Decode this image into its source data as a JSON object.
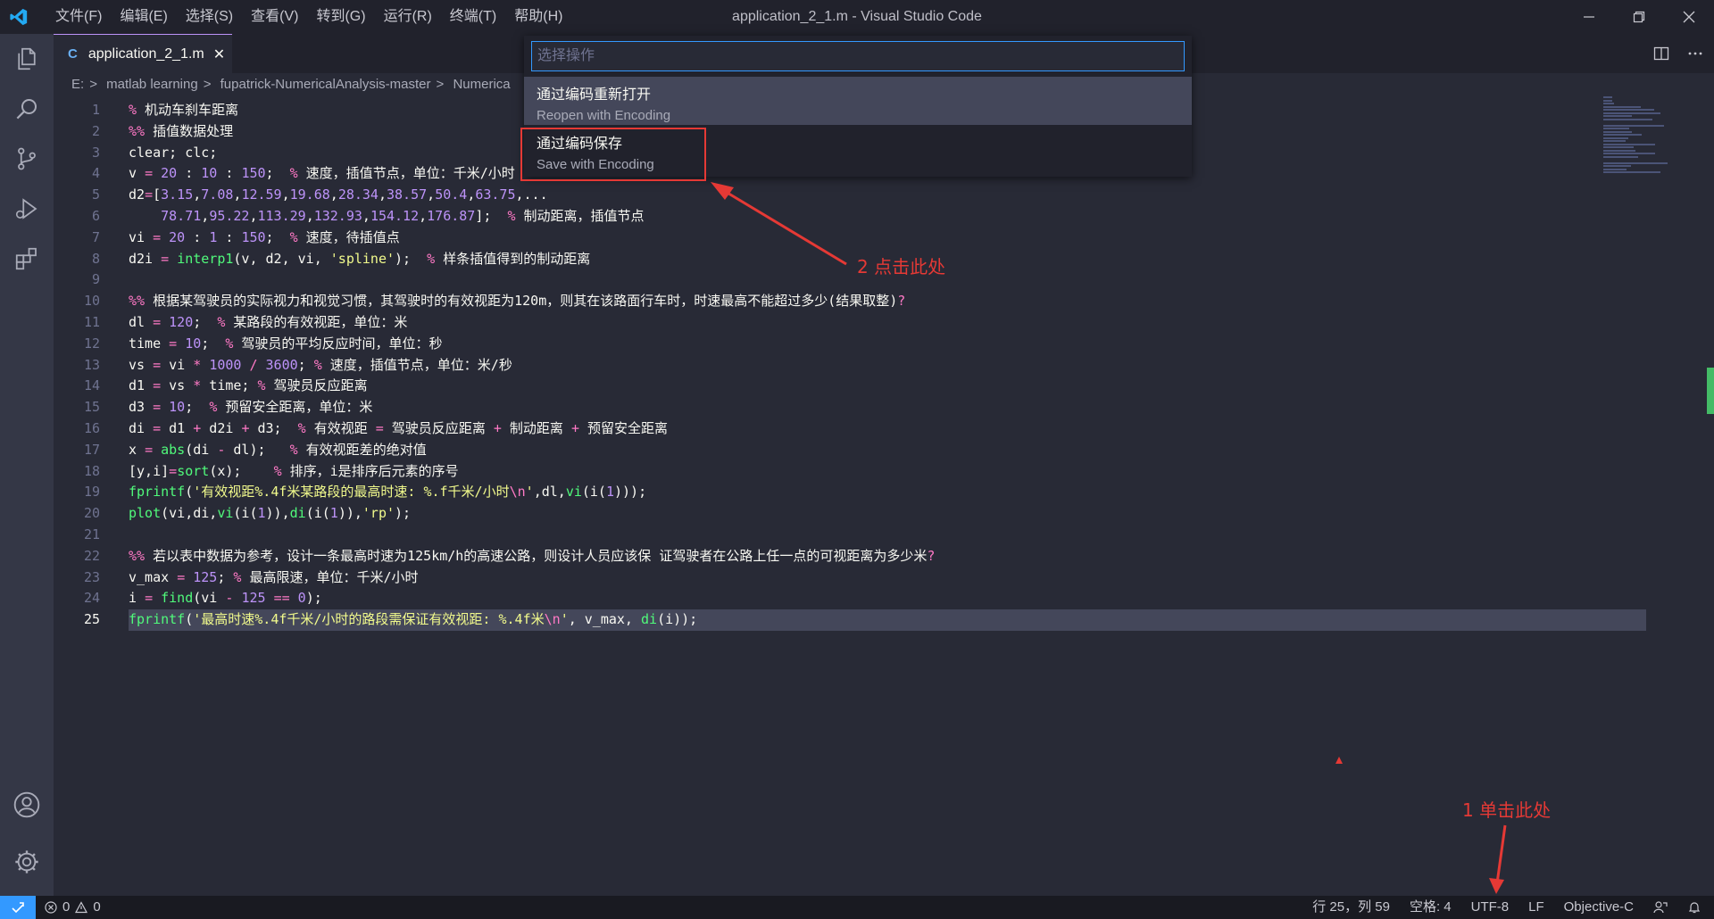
{
  "titlebar": {
    "menus": [
      "文件(F)",
      "编辑(E)",
      "选择(S)",
      "查看(V)",
      "转到(G)",
      "运行(R)",
      "终端(T)",
      "帮助(H)"
    ],
    "window_title": "application_2_1.m - Visual Studio Code"
  },
  "tab": {
    "label": "application_2_1.m",
    "lang_icon": "C"
  },
  "breadcrumb": [
    "E:",
    "matlab learning",
    "fupatrick-NumericalAnalysis-master",
    "Numerica"
  ],
  "palette": {
    "placeholder": "选择操作",
    "items": [
      {
        "title": "通过编码重新打开",
        "subtitle": "Reopen with Encoding"
      },
      {
        "title": "通过编码保存",
        "subtitle": "Save with Encoding"
      }
    ]
  },
  "code": {
    "current_line": 25,
    "lines": [
      "% 机动车刹车距离",
      "%% 插值数据处理",
      "clear; clc;",
      "v = 20 : 10 : 150;  % 速度，插值节点，单位：千米/小时",
      "d2=[3.15,7.08,12.59,19.68,28.34,38.57,50.4,63.75,...",
      "    78.71,95.22,113.29,132.93,154.12,176.87];  % 制动距离，插值节点",
      "vi = 20 : 1 : 150;  % 速度，待插值点",
      "d2i = interp1(v, d2, vi, 'spline');  % 样条插值得到的制动距离",
      "",
      "%% 根据某驾驶员的实际视力和视觉习惯，其驾驶时的有效视距为120m，则其在该路面行车时，时速最高不能超过多少(结果取整)?",
      "dl = 120;  % 某路段的有效视距，单位：米",
      "time = 10;  % 驾驶员的平均反应时间，单位：秒",
      "vs = vi * 1000 / 3600; % 速度，插值节点，单位：米/秒",
      "d1 = vs * time; % 驾驶员反应距离",
      "d3 = 10;  % 预留安全距离，单位：米",
      "di = d1 + d2i + d3;  % 有效视距 = 驾驶员反应距离 + 制动距离 + 预留安全距离",
      "x = abs(di - dl);   % 有效视距差的绝对值",
      "[y,i]=sort(x);    % 排序，i是排序后元素的序号",
      "fprintf('有效视距%.4f米某路段的最高时速: %.f千米/小时\\n',dl,vi(i(1)));",
      "plot(vi,di,vi(i(1)),di(i(1)),'rp');",
      "",
      "%% 若以表中数据为参考，设计一条最高时速为125km/h的高速公路，则设计人员应该保 证驾驶者在公路上任一点的可视距离为多少米?",
      "v_max = 125; % 最高限速，单位：千米/小时",
      "i = find(vi - 125 == 0);",
      "fprintf('最高时速%.4f千米/小时的路段需保证有效视距: %.4f米\\n', v_max, di(i));"
    ]
  },
  "annotations": {
    "step2": "2 点击此处",
    "step1": "1 单击此处"
  },
  "statusbar": {
    "errors": "0",
    "warnings": "0",
    "position": "行 25，列 59",
    "spaces": "空格: 4",
    "encoding": "UTF-8",
    "eol": "LF",
    "language": "Objective-C"
  },
  "colors": {
    "accent": "#3399ff",
    "annotation": "#e53935",
    "editor_bg": "#282a36"
  }
}
